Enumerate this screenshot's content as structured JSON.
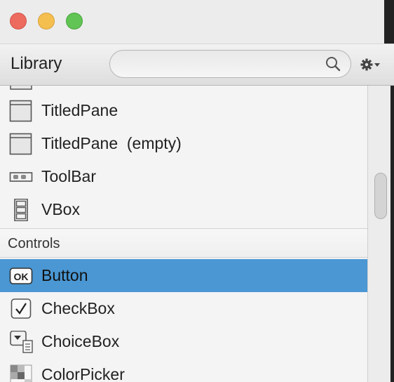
{
  "window": {
    "title_bar_buttons": [
      "close",
      "minimize",
      "zoom"
    ]
  },
  "toolbar": {
    "title": "Library",
    "search_value": "",
    "search_placeholder": "",
    "icons": [
      "search-icon",
      "gear-icon"
    ]
  },
  "library": {
    "items_top": [
      {
        "label": "TitledPane",
        "icon": "titledpane-icon"
      },
      {
        "label": "TitledPane  (empty)",
        "icon": "titledpane-icon"
      },
      {
        "label": "ToolBar",
        "icon": "toolbar-icon"
      },
      {
        "label": "VBox",
        "icon": "vbox-icon"
      }
    ],
    "section_controls": "Controls",
    "items_controls": [
      {
        "label": "Button",
        "icon": "ok-button-icon",
        "selected": true
      },
      {
        "label": "CheckBox",
        "icon": "checkbox-icon",
        "selected": false
      },
      {
        "label": "ChoiceBox",
        "icon": "choicebox-icon",
        "selected": false
      },
      {
        "label": "ColorPicker",
        "icon": "colorpicker-icon",
        "selected": false
      }
    ]
  },
  "colors": {
    "selection": "#4a97d3",
    "close": "#ed6a5e",
    "minimize": "#f5bf4f",
    "zoom": "#61c454"
  }
}
